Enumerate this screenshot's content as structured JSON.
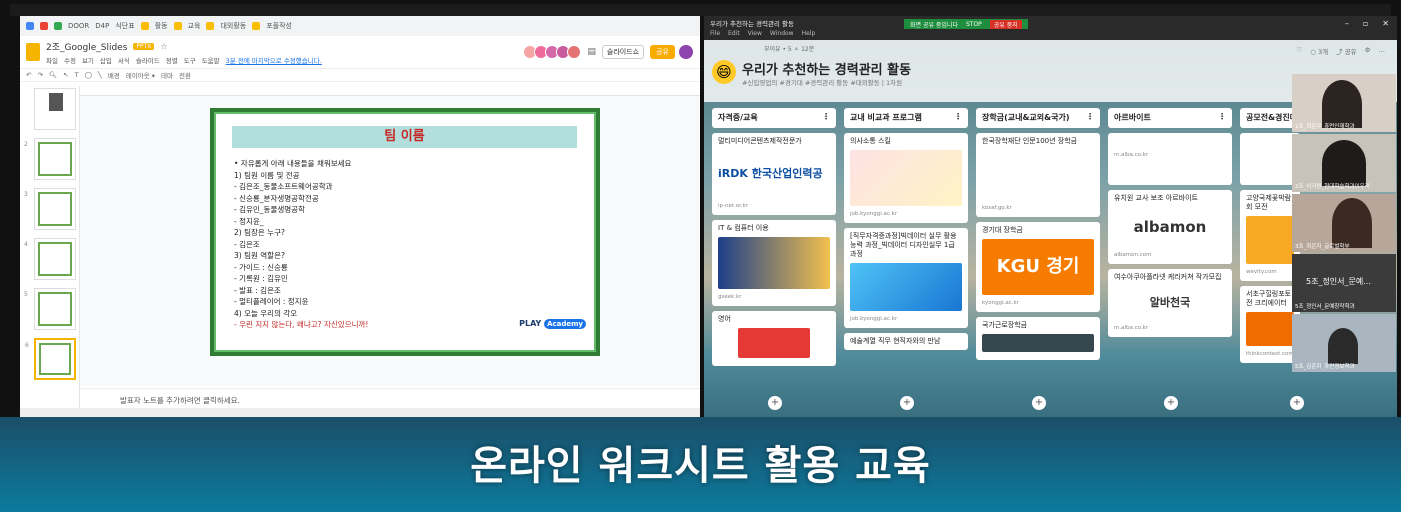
{
  "bookmarks": [
    "DOOR",
    "D4P",
    "식단표",
    "활동",
    "교육",
    "대외활동",
    "포플작성"
  ],
  "slides_app": {
    "doc_title": "2조_Google_Slides",
    "file_badge": "PPTX",
    "menu": [
      "파일",
      "수정",
      "보기",
      "삽입",
      "서식",
      "슬라이드",
      "정렬",
      "도구",
      "도움말"
    ],
    "last_edit": "3분 전에 마지막으로 수정했습니다.",
    "slideshow_label": "슬라이드쇼",
    "share_label": "공유",
    "toolbar": [
      "배경",
      "레이아웃 ▾",
      "테마",
      "전환"
    ],
    "slide_numbers": [
      "",
      "2",
      "3",
      "4",
      "5",
      "6",
      "7"
    ],
    "notes_placeholder": "발표자 노트를 추가하려면 클릭하세요.",
    "slide": {
      "title": "팀 이름",
      "lines": [
        "• 자유롭게 아래 내용들을 채워보세요",
        "  1) 팀원 이름 및 전공",
        "   - 김은조_동물소프트웨어공학과",
        "   - 신승룡_분자생명공학전공",
        "   - 김유민_동물생명공학",
        "   - 정지윤_",
        "  2) 팀장은 누구?",
        "   - 김은조",
        "  3) 팀원 역할은?",
        "   - 가이드 : 신승룡",
        "   - 기록원 : 김유민",
        "   - 발표 : 김은조",
        "   - 멀티플레이어 : 정지윤",
        "  4) 오늘 우리의 각오"
      ],
      "last_line": "   - 우린 지지 않는다, 왜냐고? 자신있으니까!",
      "logo_text": "PLAY",
      "logo_badge": "Academy"
    }
  },
  "padlet": {
    "window_title": "우리가 추천하는 경력관리 활동",
    "window_menu": [
      "File",
      "Edit",
      "View",
      "Window",
      "Help"
    ],
    "meet_bar": [
      "화면 공유 중입니다",
      "STOP",
      "공유 중지"
    ],
    "author": "부이유 • 5 ㅅ 12분",
    "title": "우리가 추천하는 경력관리 활동",
    "subtitle": "#신입영업의 #경기대 #경력관리 활동 #대외활동 | 1차원",
    "header_tools": [
      "♡",
      "○ 3개",
      "⤴ 공유",
      "⚙",
      "…"
    ],
    "columns": [
      {
        "title": "자격증/교육",
        "cards": [
          {
            "text": "멀티미디어콘텐츠제작전문가",
            "logo": "iRDK 한국산업인력공",
            "meta": "ip-net.or.kr"
          },
          {
            "text": "IT & 컴퓨터 이용",
            "meta": "gseek.kr"
          },
          {
            "text": "영어",
            "meta": ""
          }
        ]
      },
      {
        "title": "교내 비교과 프로그램",
        "cards": [
          {
            "text": "의사소통 스킬",
            "meta": "job.kyonggi.ac.kr"
          },
          {
            "text": "[직무자격증과정]빅데이터 실무 활용 능력 과정_빅데이터 디자인실무 1급 과정",
            "meta": "job.kyonggi.ac.kr"
          },
          {
            "text": "예술계열 직무 현직자와의 만남",
            "meta": ""
          }
        ]
      },
      {
        "title": "장학금(교내&교외&국가)",
        "cards": [
          {
            "text": "한국장학재단 인문100년 장학금",
            "meta": "kosaf.go.kr"
          },
          {
            "text": "경기대 장학금",
            "logo": "KGU 경기",
            "meta": "kyonggi.ac.kr"
          },
          {
            "text": "국가근로장학금",
            "meta": ""
          }
        ]
      },
      {
        "title": "아르바이트",
        "cards": [
          {
            "text": "유치원 교사 보조 아르바이트",
            "logo": "albamon",
            "meta": "albamon.com"
          },
          {
            "text": "여수아쿠아플라넷 케리커쳐 작가모집",
            "logo": "알바천국",
            "meta": "m.alba.co.kr"
          }
        ]
      },
      {
        "title": "공모전&경진대회",
        "cards": [
          {
            "text": "고양국제꽃박람회 모전",
            "meta": "wevity.com"
          },
          {
            "text": "서초구힐링포토 전 크리에이터",
            "meta": "thinkcontest.com"
          }
        ]
      }
    ],
    "participants": [
      "1조_최운우_휴먼인재학과",
      "2조_이지원_현대학습학과이우리",
      "3조_최은지_글로벌학부",
      "5조_정인서_문예...",
      "5조_정인서_문예창작학과",
      "5조_김준하_휴먼정보학과"
    ]
  },
  "banner": {
    "title": "온라인 워크시트 활용 교육"
  }
}
